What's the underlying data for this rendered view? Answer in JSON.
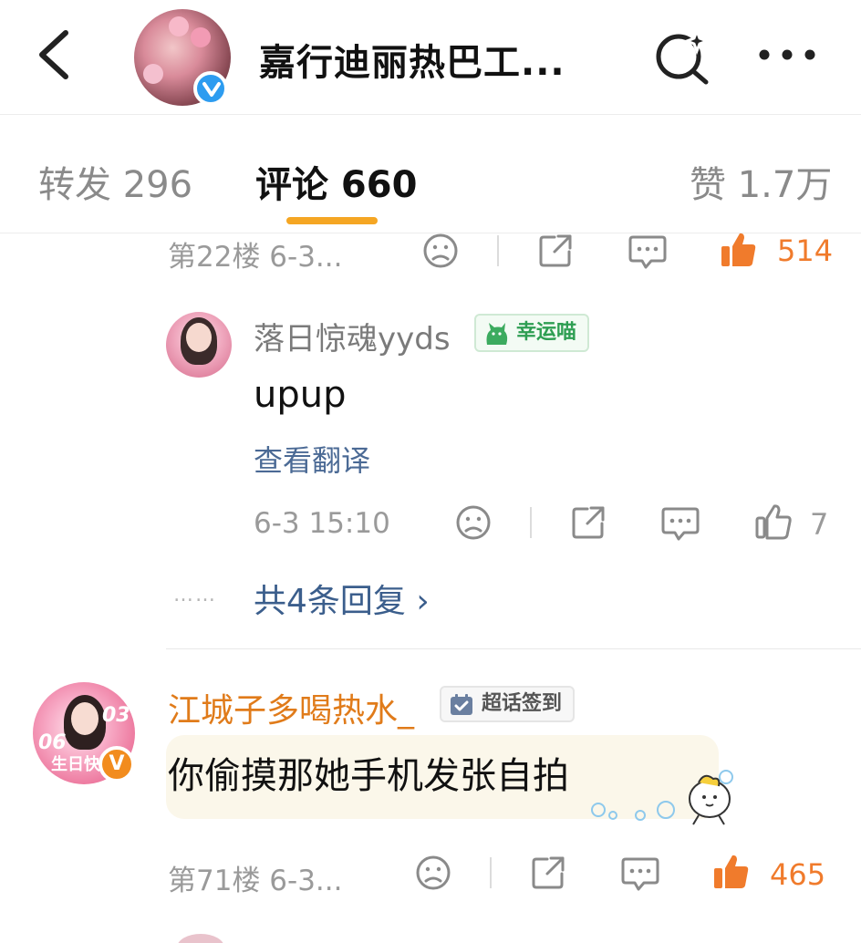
{
  "header": {
    "title": "嘉行迪丽热巴工...",
    "icons": {
      "back": "chevron-left-icon",
      "search": "search-sparkle-icon",
      "more": "more-dots-icon"
    }
  },
  "tabs": [
    {
      "label": "转发 296"
    },
    {
      "label": "评论 660",
      "active": true
    },
    {
      "label": "赞 1.7万"
    }
  ],
  "top_comment_actions": {
    "meta": "第22楼  6-3...",
    "like_count": "514"
  },
  "reply": {
    "username": "落日惊魂yyds",
    "badge": "幸运喵",
    "text": "upup",
    "translate": "查看翻译",
    "time": "6-3 15:10",
    "like_count": "7",
    "more_replies_dots": "……",
    "more_replies": "共4条回复 ›"
  },
  "comment": {
    "username": "江城子多喝热水_",
    "badge": "超话签到",
    "avatar_text": {
      "num_top": "03",
      "num_left": "06",
      "label": "生日快"
    },
    "text": "你偷摸那她手机发张自拍",
    "meta": "第71楼  6-3...",
    "like_count": "465"
  },
  "colors": {
    "accent": "#f5a623",
    "like_active": "#f07b2c",
    "link_blue": "#3b5e8c",
    "verified_blue": "#2d9cf0",
    "name_orange": "#e07b1a"
  }
}
